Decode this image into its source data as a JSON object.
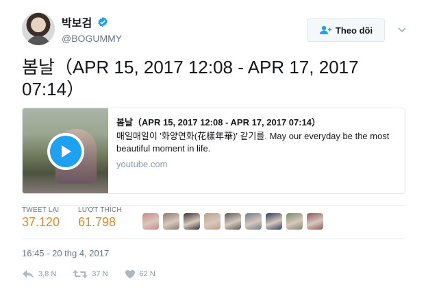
{
  "profile": {
    "display_name": "박보검",
    "handle": "@BOGUMMY",
    "verified_icon": "verified-badge-icon",
    "avatar_icon": "user-avatar"
  },
  "follow_button": {
    "label": "Theo dõi",
    "icon": "add-user-icon"
  },
  "tweet": {
    "text": "봄날（APR 15, 2017 12:08 - APR 17, 2017 07:14）"
  },
  "card": {
    "title": "봄날（APR 15, 2017 12:08 - APR 17, 2017 07:14）",
    "description": "매일매일이 '화양연화(花樣年華)' 같기를. May our everyday be the most beautiful moment in life.",
    "domain": "youtube.com",
    "play_icon": "play-icon"
  },
  "stats": {
    "retweets_label": "TWEET LẠI",
    "retweets_value": "37.120",
    "likes_label": "LƯỢT THÍCH",
    "likes_value": "61.798",
    "liker_avatar_colors": [
      "#c98a8a",
      "#8b7b74",
      "#3b3535",
      "#b9a08c",
      "#5c5c5c",
      "#6e7b8c",
      "#2d3f63",
      "#7a8a6a",
      "#8c5a5a"
    ]
  },
  "timestamp": "16:45 - 20 thg 4, 2017",
  "actions": {
    "reply_count": "3,8 N",
    "retweet_count": "37 N",
    "like_count": "62 N"
  },
  "colors": {
    "accent": "#1da1f2",
    "stat_value": "#e0882a",
    "muted": "#657786"
  }
}
